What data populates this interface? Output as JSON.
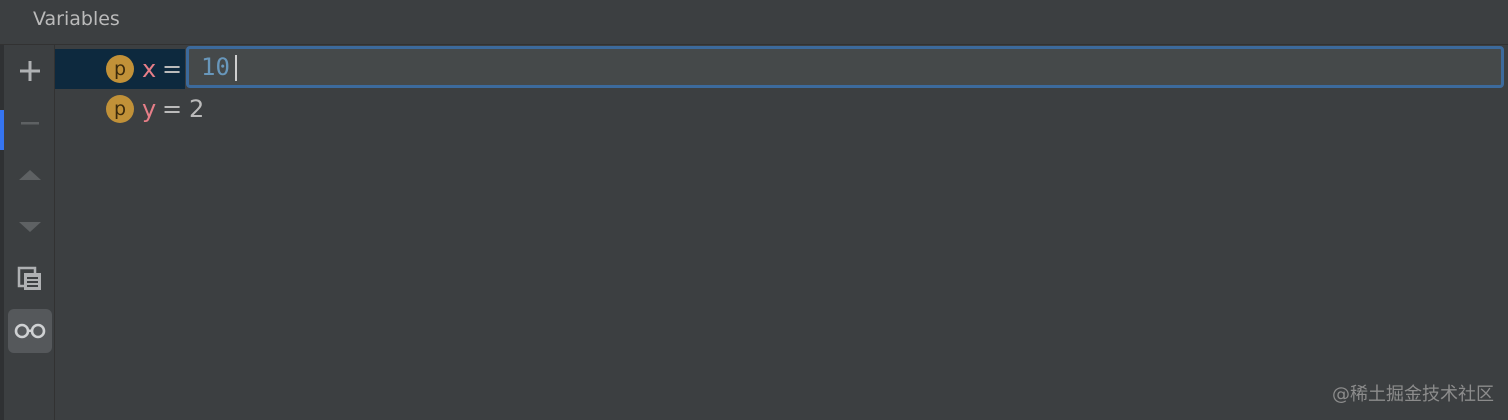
{
  "panel": {
    "title": "Variables"
  },
  "toolbar": {
    "buttons": [
      {
        "name": "add-icon",
        "label": "+"
      },
      {
        "name": "remove-icon",
        "label": "−"
      },
      {
        "name": "move-up-icon",
        "label": "▲"
      },
      {
        "name": "move-down-icon",
        "label": "▼"
      },
      {
        "name": "copy-icon",
        "label": "copy"
      },
      {
        "name": "watch-glasses-icon",
        "label": "glasses",
        "active": true
      }
    ]
  },
  "variables": [
    {
      "badge": "p",
      "name": "x",
      "equals": "=",
      "value": "10",
      "editing": true
    },
    {
      "badge": "p",
      "name": "y",
      "equals": "=",
      "value": "2",
      "editing": false
    }
  ],
  "colors": {
    "background": "#3c3f41",
    "selection": "#0d293e",
    "badge": "#c19138",
    "var_name": "#e67e88",
    "edit_border": "#3c6a9c",
    "edit_value": "#6897bb"
  },
  "watermark": "@稀土掘金技术社区"
}
